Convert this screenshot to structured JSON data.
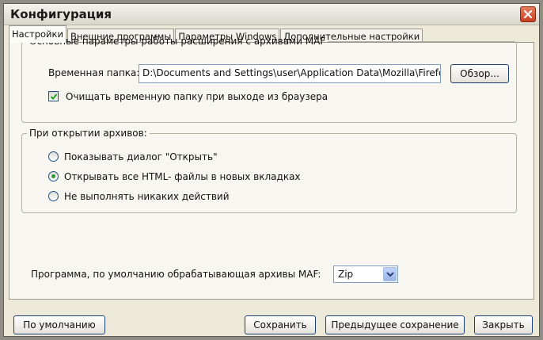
{
  "window": {
    "title": "Конфигурация"
  },
  "tabs": [
    {
      "label": "Настройки",
      "active": true
    },
    {
      "label": "Внешние программы",
      "active": false
    },
    {
      "label": "Параметры Windows",
      "active": false
    },
    {
      "label": "Дополнительные настройки",
      "active": false
    }
  ],
  "main_group": {
    "legend": "Основные параметры работы расширения с архивами MAF",
    "temp_folder_label": "Временная папка:",
    "temp_folder_value": "D:\\Documents and Settings\\user\\Application Data\\Mozilla\\Firefox",
    "browse_button": "Обзор...",
    "clear_checkbox_label": "Очищать временную папку при выходе из браузера",
    "clear_checkbox_checked": true
  },
  "open_group": {
    "legend": "При открытии архивов:",
    "options": [
      {
        "label": "Показывать диалог \"Открыть\"",
        "selected": false
      },
      {
        "label": "Открывать все HTML- файлы в новых вкладках",
        "selected": true
      },
      {
        "label": "Не выполнять никаких действий",
        "selected": false
      }
    ]
  },
  "default_program": {
    "label": "Программа, по умолчанию обрабатывающая архивы MAF:",
    "selected": "Zip"
  },
  "buttons": {
    "defaults": "По умолчанию",
    "save": "Сохранить",
    "previous_save": "Предыдущее сохранение",
    "close": "Закрыть"
  },
  "colors": {
    "dialog_background": "#ece9d8",
    "close_button": "#c8401f",
    "radio_selected": "#2f9b2f"
  }
}
